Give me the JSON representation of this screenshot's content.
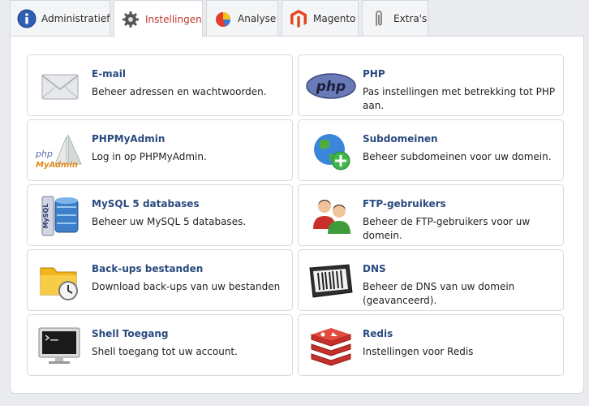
{
  "tabs": [
    {
      "label": "Administratief",
      "icon": "info-icon",
      "active": false
    },
    {
      "label": "Instellingen",
      "icon": "settings-gear-icon",
      "active": true
    },
    {
      "label": "Analyse",
      "icon": "pie-chart-icon",
      "active": false
    },
    {
      "label": "Magento",
      "icon": "magento-logo-icon",
      "active": false
    },
    {
      "label": "Extra's",
      "icon": "paperclip-icon",
      "active": false
    }
  ],
  "cards": [
    {
      "title": "E-mail",
      "desc": "Beheer adressen en wachtwoorden.",
      "icon": "envelope-icon"
    },
    {
      "title": "PHP",
      "desc": "Pas instellingen met betrekking tot PHP aan.",
      "icon": "php-logo-icon"
    },
    {
      "title": "PHPMyAdmin",
      "desc": "Log in op PHPMyAdmin.",
      "icon": "phpmyadmin-logo-icon"
    },
    {
      "title": "Subdomeinen",
      "desc": "Beheer subdomeinen voor uw domein.",
      "icon": "globe-add-icon"
    },
    {
      "title": "MySQL 5 databases",
      "desc": "Beheer uw MySQL 5 databases.",
      "icon": "mysql-database-icon"
    },
    {
      "title": "FTP-gebruikers",
      "desc": "Beheer de FTP-gebruikers voor uw domein.",
      "icon": "users-icon"
    },
    {
      "title": "Back-ups bestanden",
      "desc": "Download back-ups van uw bestanden",
      "icon": "folder-clock-icon"
    },
    {
      "title": "DNS",
      "desc": "Beheer de DNS van uw domein (geavanceerd).",
      "icon": "dns-server-icon"
    },
    {
      "title": "Shell Toegang",
      "desc": "Shell toegang tot uw account.",
      "icon": "terminal-monitor-icon"
    },
    {
      "title": "Redis",
      "desc": "Instellingen voor Redis",
      "icon": "redis-logo-icon"
    }
  ],
  "colors": {
    "active_tab_text": "#c0392b",
    "card_title": "#2a4a7f"
  },
  "logos": {
    "php": "php",
    "phpmyadmin_top": "php",
    "phpmyadmin_bottom": "MyAdmin",
    "mysql": "MySQL"
  }
}
